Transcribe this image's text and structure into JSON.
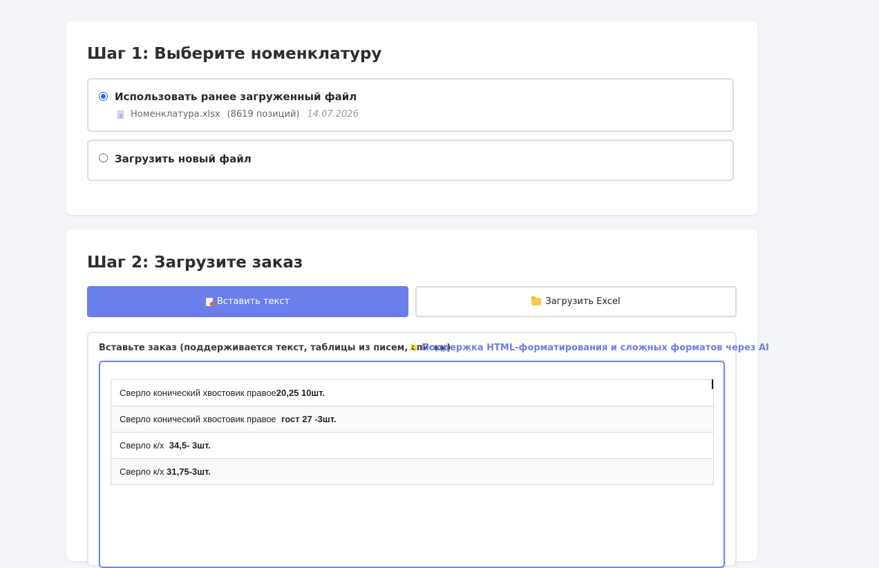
{
  "step1": {
    "title": "Шаг 1: Выберите номенклатуру",
    "option_existing": {
      "label": "Использовать ранее загруженный файл",
      "selected": true,
      "file_name": "Номенклатура.xlsx",
      "positions": "(8619 позиций)",
      "date": "14.07.2026"
    },
    "option_new": {
      "label": "Загрузить новый файл",
      "selected": false
    }
  },
  "step2": {
    "title": "Шаг 2: Загрузите заказ",
    "tabs": {
      "paste_label": "Вставить текст",
      "paste_icon": "memo-icon",
      "excel_label": "Загрузить Excel",
      "excel_icon": "folder-icon",
      "active": "paste"
    },
    "panel": {
      "label": "Вставьте заказ (поддерживается текст, таблицы из писем, списки)",
      "ai_note": "Поддержка HTML-форматирования и сложных форматов через AI",
      "ai_icon": "sparkles-icon"
    },
    "order_rows": [
      {
        "text": "Сверло конический хвостовик правое",
        "bold": "20,25 10шт."
      },
      {
        "text": "Сверло конический хвостовик правое  ",
        "bold": "гост 27 -3шт."
      },
      {
        "text": "Сверло к/х  ",
        "bold": "34,5- 3шт."
      },
      {
        "text": "Сверло к/х ",
        "bold": "31,75-3шт."
      }
    ]
  },
  "colors": {
    "accent": "#6a7fea",
    "radio": "#1a73e8",
    "background": "#f4f5f9"
  }
}
